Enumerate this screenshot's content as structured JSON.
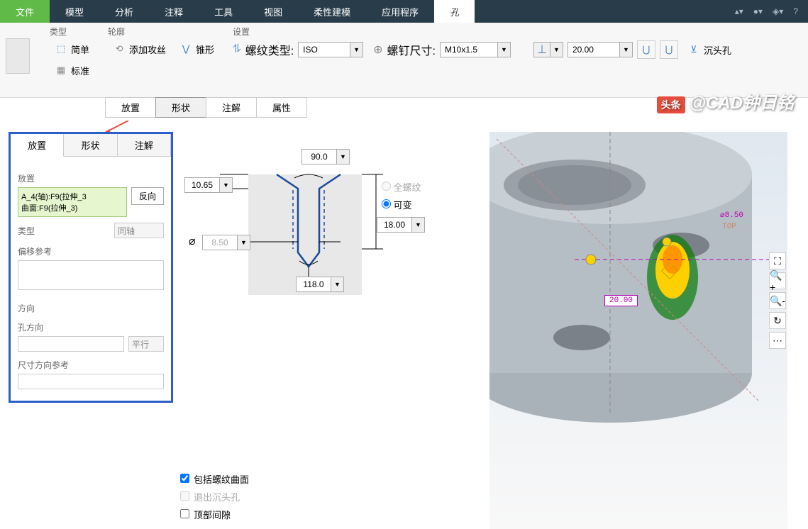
{
  "menubar": {
    "items": [
      "文件",
      "模型",
      "分析",
      "注释",
      "工具",
      "视图",
      "柔性建模",
      "应用程序",
      "孔"
    ]
  },
  "ribbon": {
    "groups": {
      "type": {
        "label": "类型",
        "simple": "简单",
        "standard": "标准"
      },
      "profile": {
        "label": "轮廓",
        "tapping": "添加攻丝",
        "taper": "锥形"
      },
      "settings": {
        "label": "设置",
        "thread_type_label": "螺纹类型:",
        "thread_type_value": "ISO",
        "screw_size_label": "螺钉尺寸:",
        "screw_size_value": "M10x1.5",
        "depth_value": "20.00",
        "csink_label": "沉头孔"
      }
    }
  },
  "subtabs": {
    "place": "放置",
    "shape": "形状",
    "note": "注解",
    "attr": "属性"
  },
  "panel": {
    "tabs": {
      "place": "放置",
      "shape": "形状",
      "note": "注解"
    },
    "place_label": "放置",
    "selection": [
      "A_4(轴):F9(拉伸_3",
      "曲面:F9(拉伸_3)"
    ],
    "reverse_btn": "反向",
    "type_label": "类型",
    "type_value": "同轴",
    "offset_label": "偏移参考",
    "dir_label": "方向",
    "hole_dir_label": "孔方向",
    "hole_dir_value": "平行",
    "dim_dir_label": "尺寸方向参考"
  },
  "diagram": {
    "angle_top": "90.0",
    "dim_left": "10.65",
    "depth": "18.00",
    "angle_bottom": "118.0",
    "diameter": "8.50",
    "radio_full": "全螺纹",
    "radio_var": "可变",
    "chk_thread_surf": "包括螺纹曲面",
    "chk_exit_csink": "退出沉头孔",
    "chk_top_gap": "顶部间隙"
  },
  "viewport": {
    "dia_callout": "⌀8.50",
    "top_label": "TOP",
    "dim_20": "20.00"
  },
  "watermark": {
    "logo": "头条",
    "text": "@CAD钟日铭"
  }
}
